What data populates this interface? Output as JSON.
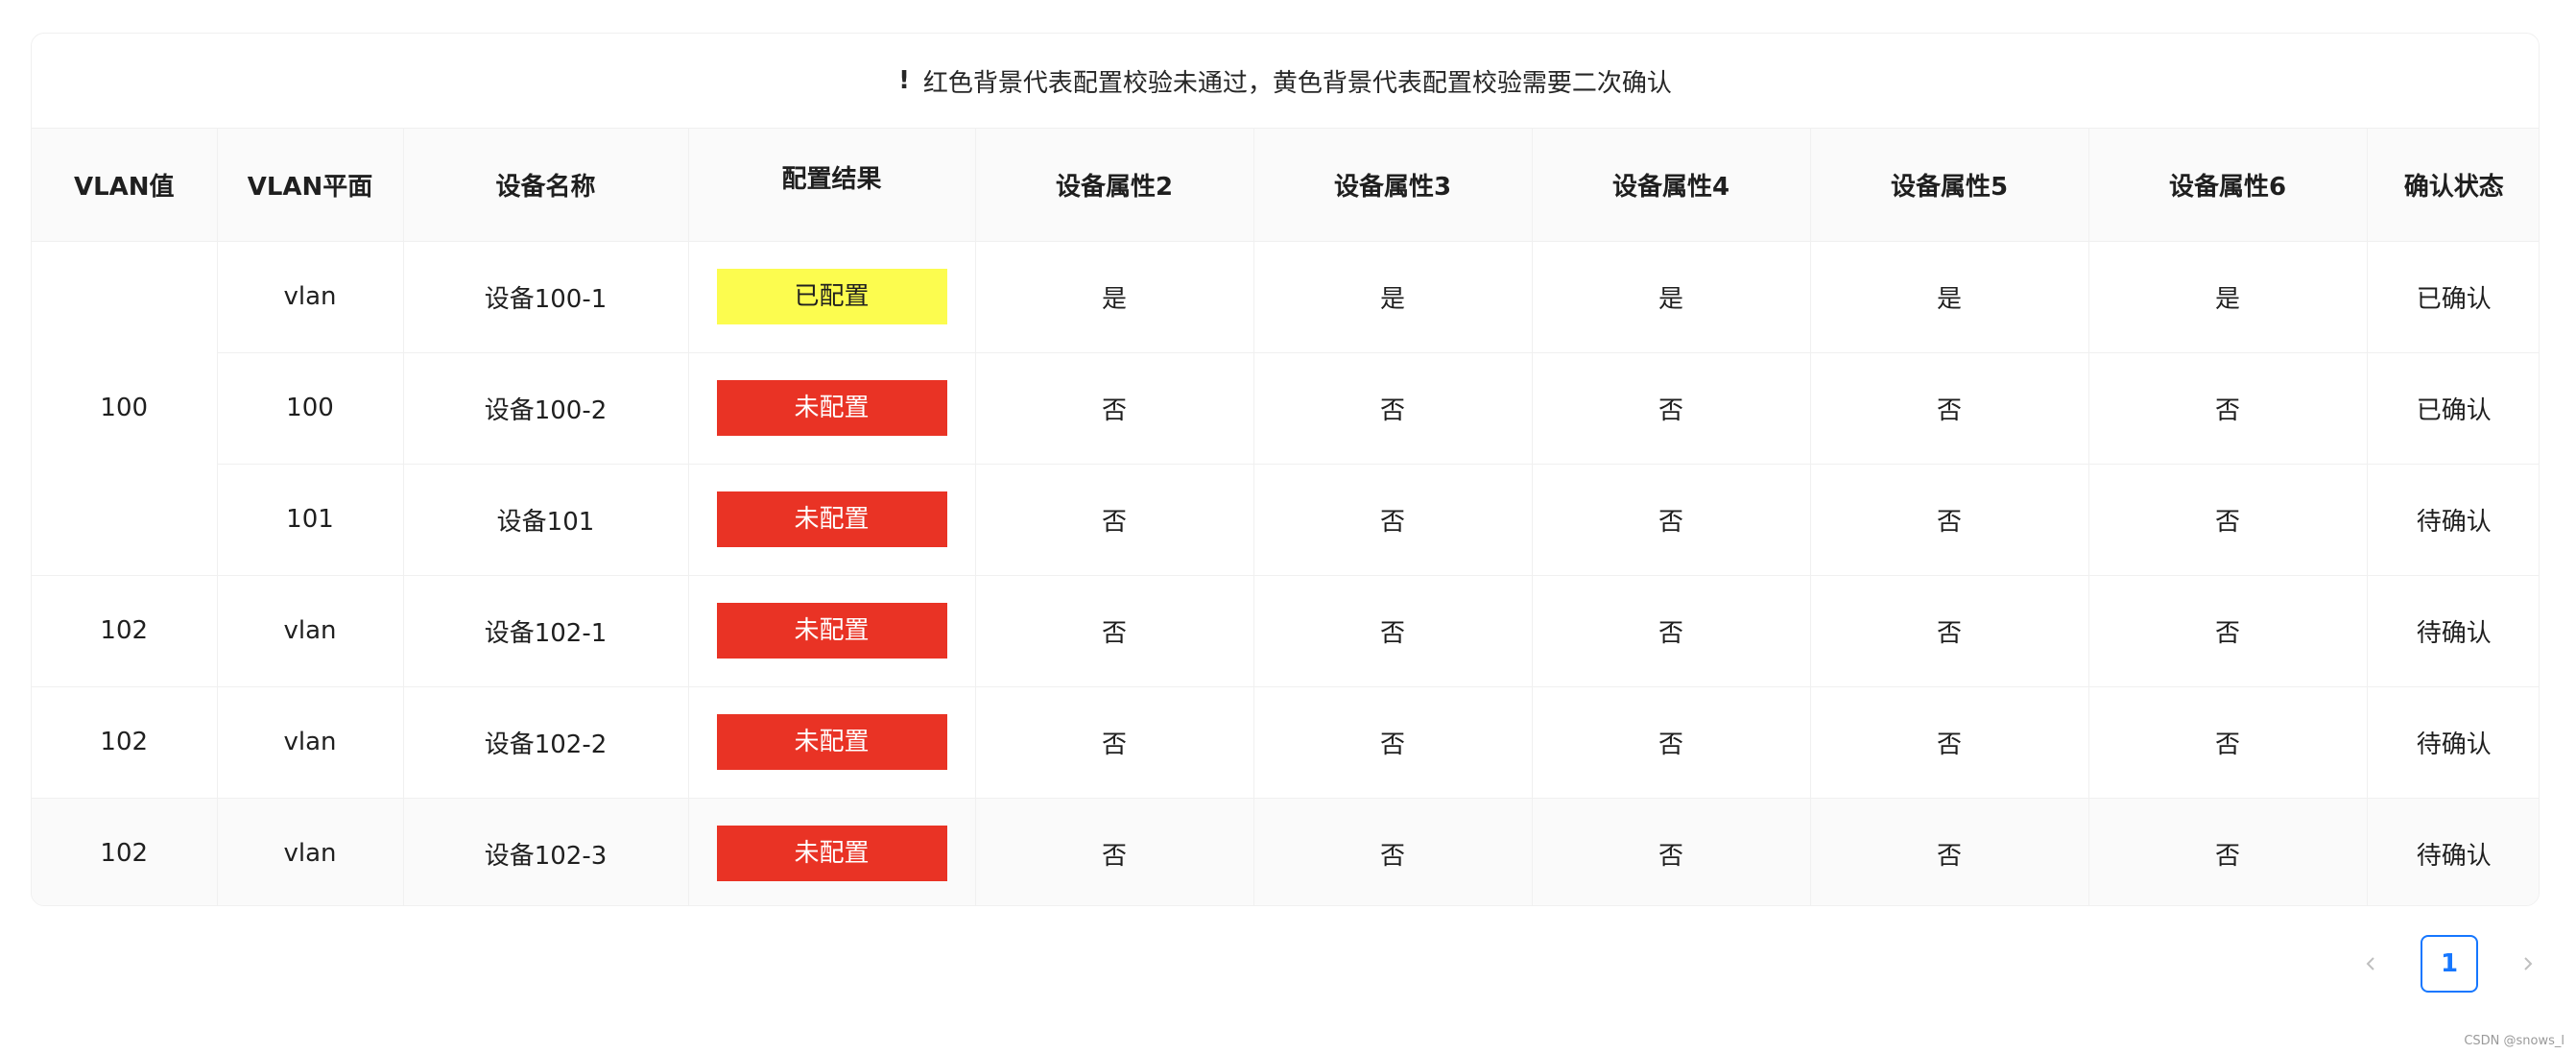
{
  "notice": {
    "icon": "!",
    "text": "红色背景代表配置校验未通过，黄色背景代表配置校验需要二次确认"
  },
  "table": {
    "columns": [
      "VLAN值",
      "VLAN平面",
      "设备名称",
      "配置结果",
      "设备属性2",
      "设备属性3",
      "设备属性4",
      "设备属性5",
      "设备属性6",
      "确认状态"
    ],
    "rows": [
      {
        "vlan": "100",
        "plane": "vlan",
        "device": "设备100-1",
        "result": "已配置",
        "result_color": "#fcfc4f",
        "result_text_color": "#1f1f1f",
        "a2": "是",
        "a3": "是",
        "a4": "是",
        "a5": "是",
        "a6": "是",
        "status": "已确认"
      },
      {
        "vlan": "",
        "plane": "100",
        "device": "设备100-2",
        "result": "未配置",
        "result_color": "#e93325",
        "result_text_color": "#ffffff",
        "a2": "否",
        "a3": "否",
        "a4": "否",
        "a5": "否",
        "a6": "否",
        "status": "已确认"
      },
      {
        "vlan": "",
        "plane": "101",
        "device": "设备101",
        "result": "未配置",
        "result_color": "#e93325",
        "result_text_color": "#ffffff",
        "a2": "否",
        "a3": "否",
        "a4": "否",
        "a5": "否",
        "a6": "否",
        "status": "待确认"
      },
      {
        "vlan": "102",
        "plane": "vlan",
        "device": "设备102-1",
        "result": "未配置",
        "result_color": "#e93325",
        "result_text_color": "#ffffff",
        "a2": "否",
        "a3": "否",
        "a4": "否",
        "a5": "否",
        "a6": "否",
        "status": "待确认"
      },
      {
        "vlan": "102",
        "plane": "vlan",
        "device": "设备102-2",
        "result": "未配置",
        "result_color": "#e93325",
        "result_text_color": "#ffffff",
        "a2": "否",
        "a3": "否",
        "a4": "否",
        "a5": "否",
        "a6": "否",
        "status": "待确认"
      },
      {
        "vlan": "102",
        "plane": "vlan",
        "device": "设备102-3",
        "result": "未配置",
        "result_color": "#e93325",
        "result_text_color": "#ffffff",
        "a2": "否",
        "a3": "否",
        "a4": "否",
        "a5": "否",
        "a6": "否",
        "status": "待确认"
      }
    ]
  },
  "pagination": {
    "prev_icon": "chevron-left-icon",
    "current_page": "1",
    "next_icon": "chevron-right-icon",
    "accent_color": "#1677ff"
  },
  "watermark": "CSDN @snows_l"
}
